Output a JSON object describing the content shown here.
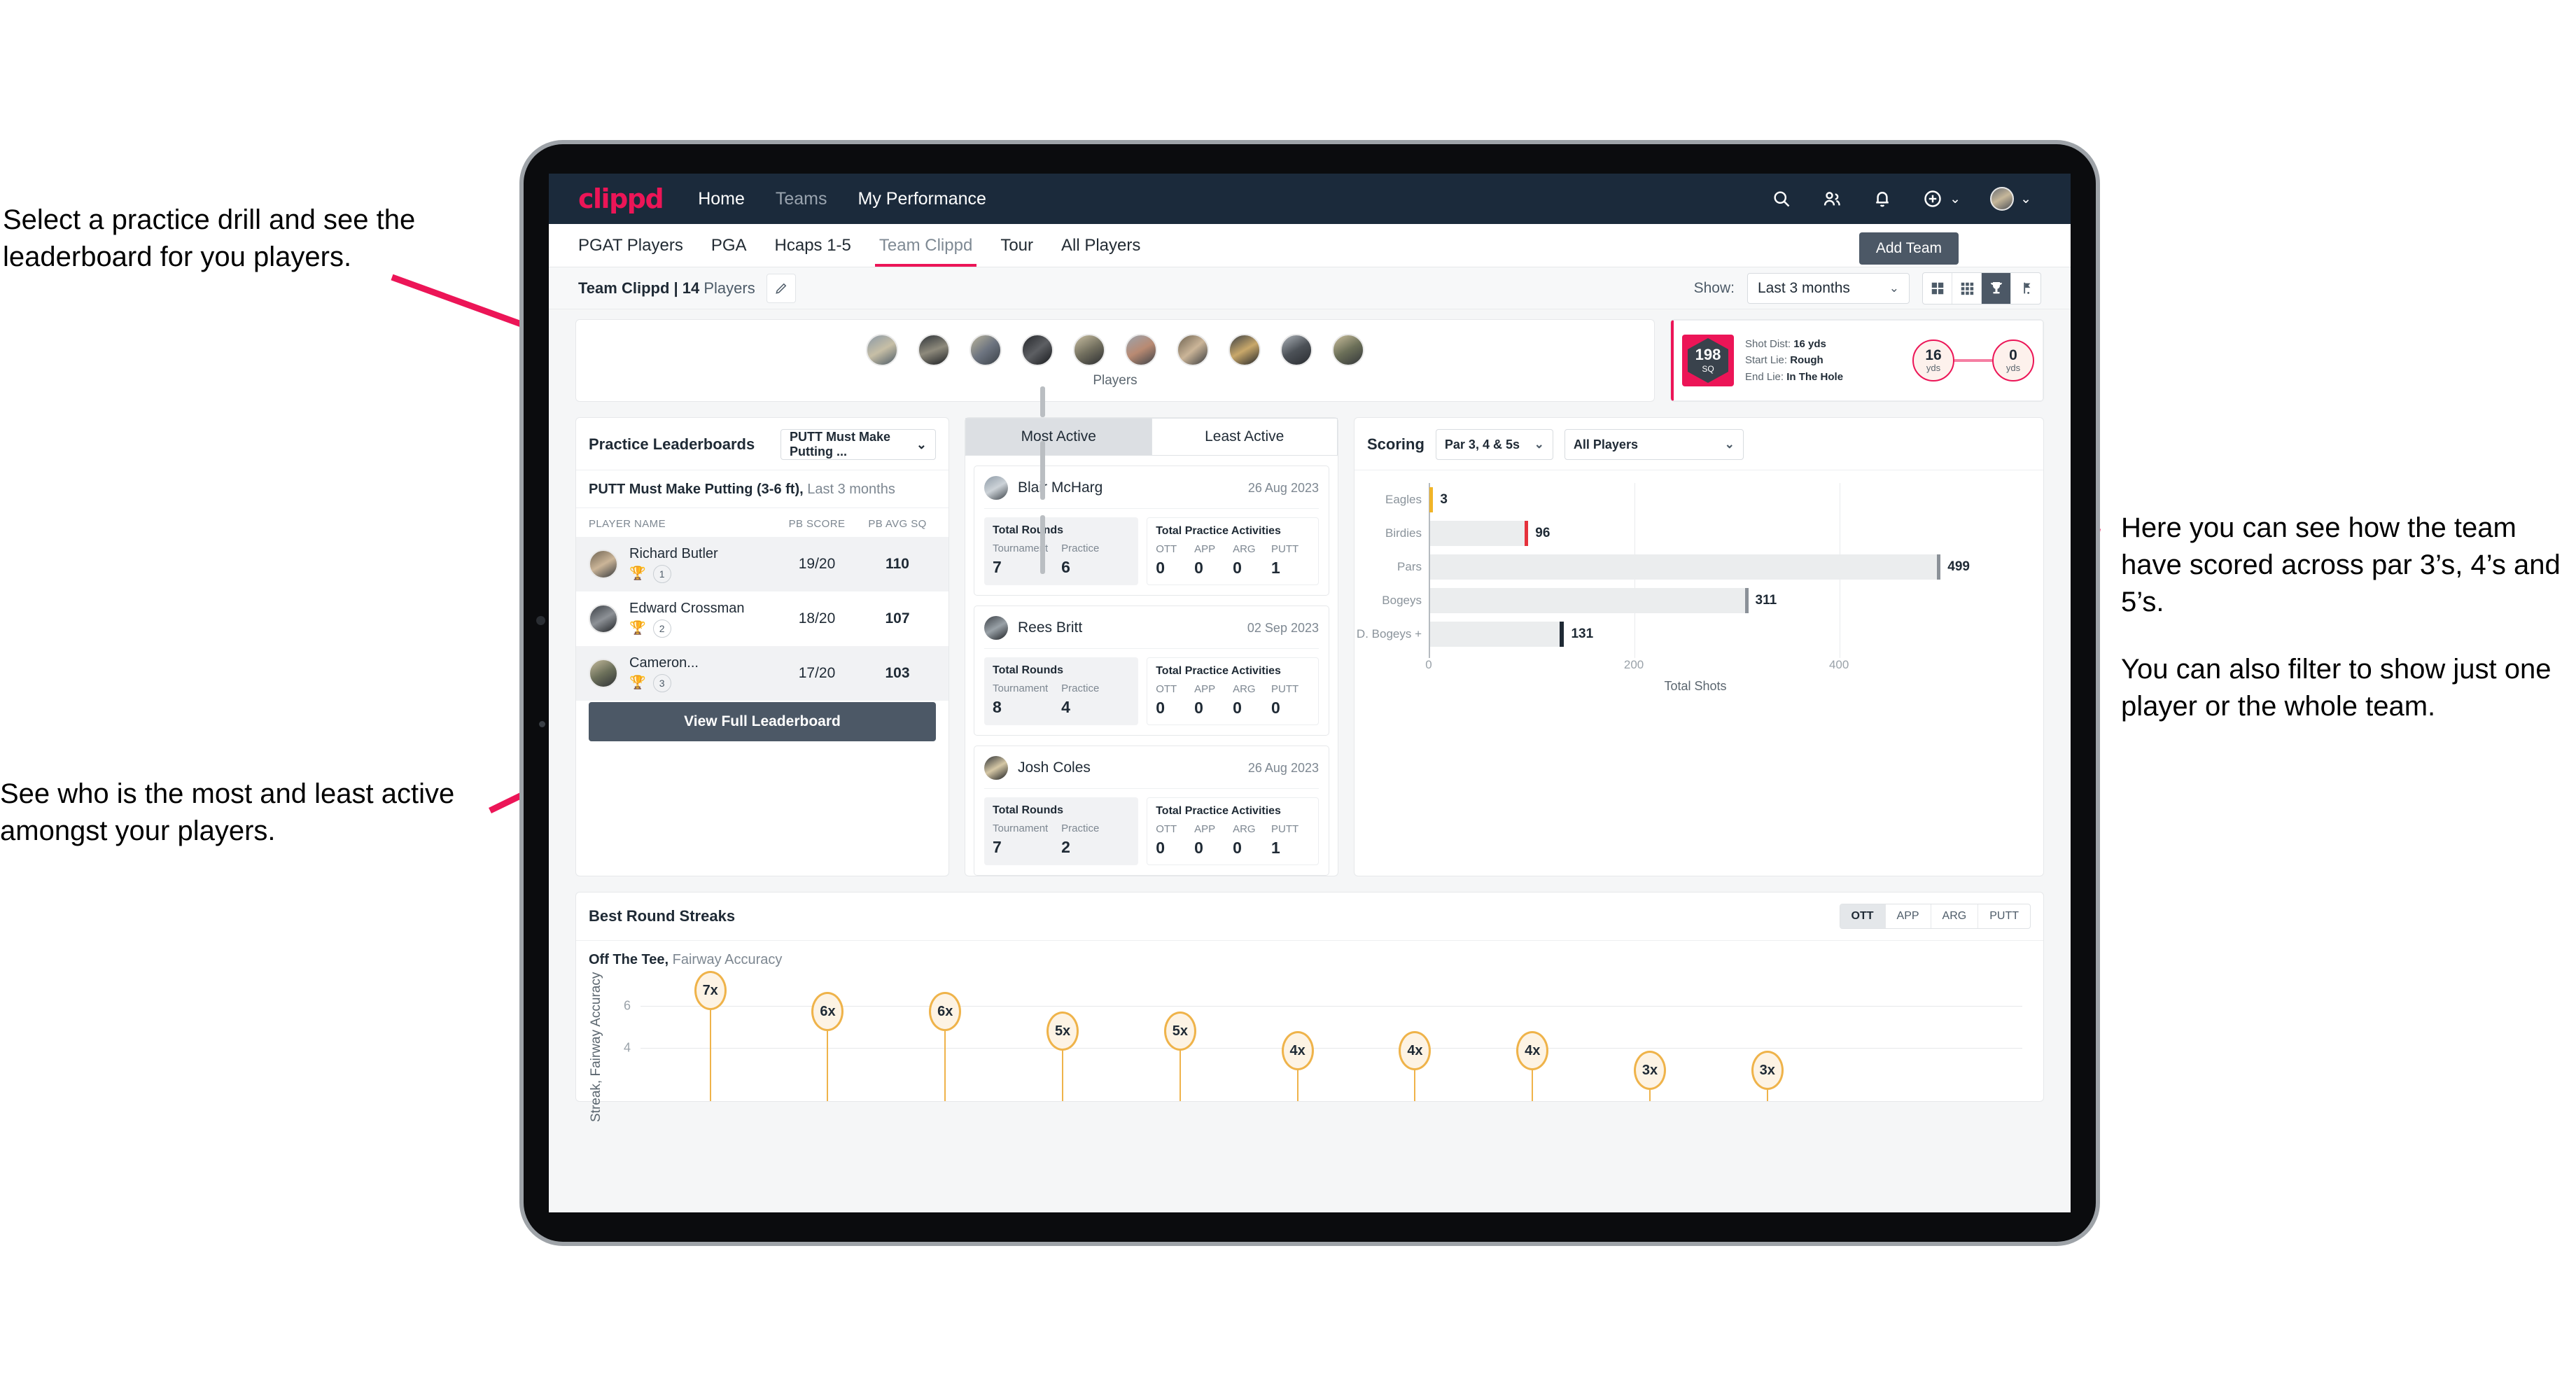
{
  "annotations": {
    "top_left": "Select a practice drill and see the leaderboard for you players.",
    "bottom_left": "See who is the most and least active amongst your players.",
    "right_1": "Here you can see how the team have scored across par 3’s, 4’s and 5’s.",
    "right_2": "You can also filter to show just one player or the whole team."
  },
  "colors": {
    "brand_pink": "#ec1557",
    "navy": "#1b2a3b",
    "slate": "#4c5866",
    "amber": "#efb34a"
  },
  "navbar": {
    "logo": "clippd",
    "links": [
      {
        "label": "Home",
        "active": true
      },
      {
        "label": "Teams",
        "active": false
      },
      {
        "label": "My Performance",
        "active": true
      }
    ],
    "icons": [
      "search-icon",
      "people-icon",
      "bell-icon",
      "plus-circle-icon",
      "avatar"
    ]
  },
  "tabs": {
    "items": [
      {
        "label": "PGAT Players",
        "active": false
      },
      {
        "label": "PGA",
        "active": false
      },
      {
        "label": "Hcaps 1-5",
        "active": false
      },
      {
        "label": "Team Clippd",
        "active": true
      },
      {
        "label": "Tour",
        "active": false
      },
      {
        "label": "All Players",
        "active": false
      }
    ],
    "add_team_label": "Add Team"
  },
  "subheader": {
    "team_name": "Team Clippd | 14",
    "team_suffix": " Players",
    "show_label": "Show:",
    "period_value": "Last 3 months",
    "view_icons": [
      {
        "name": "grid-large-icon",
        "selected": false
      },
      {
        "name": "grid-small-icon",
        "selected": false
      },
      {
        "name": "trophy-icon",
        "selected": true
      },
      {
        "name": "golf-flag-icon",
        "selected": false
      }
    ]
  },
  "players_strip": {
    "caption": "Players",
    "count": 10
  },
  "shot_card": {
    "sq_value": "198",
    "sq_unit": "SQ",
    "rows": [
      {
        "label": "Shot Dist:",
        "value": "16 yds"
      },
      {
        "label": "Start Lie:",
        "value": "Rough"
      },
      {
        "label": "End Lie:",
        "value": "In The Hole"
      }
    ],
    "start_yds": "16",
    "start_unit": "yds",
    "end_yds": "0",
    "end_unit": "yds"
  },
  "leaderboard": {
    "title": "Practice Leaderboards",
    "drill_select": "PUTT Must Make Putting ...",
    "subtitle_bold": "PUTT Must Make Putting (3-6 ft),",
    "subtitle_rest": " Last 3 months",
    "columns": [
      "PLAYER NAME",
      "PB SCORE",
      "PB AVG SQ"
    ],
    "rows": [
      {
        "name": "Richard Butler",
        "rank": "1",
        "medal": "gold",
        "pb_score": "19/20",
        "pb_avg_sq": "110"
      },
      {
        "name": "Edward Crossman",
        "rank": "2",
        "medal": "silver",
        "pb_score": "18/20",
        "pb_avg_sq": "107"
      },
      {
        "name": "Cameron...",
        "rank": "3",
        "medal": "bronze",
        "pb_score": "17/20",
        "pb_avg_sq": "103"
      }
    ],
    "button_label": "View Full Leaderboard"
  },
  "activity": {
    "tabs": [
      {
        "label": "Most Active",
        "active": true
      },
      {
        "label": "Least Active",
        "active": false
      }
    ],
    "rounds_title": "Total Rounds",
    "rounds_keys": [
      "Tournament",
      "Practice"
    ],
    "practice_title": "Total Practice Activities",
    "practice_keys": [
      "OTT",
      "APP",
      "ARG",
      "PUTT"
    ],
    "cards": [
      {
        "name": "Blair McHarg",
        "date": "26 Aug 2023",
        "rounds": [
          "7",
          "6"
        ],
        "practice": [
          "0",
          "0",
          "0",
          "1"
        ]
      },
      {
        "name": "Rees Britt",
        "date": "02 Sep 2023",
        "rounds": [
          "8",
          "4"
        ],
        "practice": [
          "0",
          "0",
          "0",
          "0"
        ]
      },
      {
        "name": "Josh Coles",
        "date": "26 Aug 2023",
        "rounds": [
          "7",
          "2"
        ],
        "practice": [
          "0",
          "0",
          "0",
          "1"
        ]
      }
    ]
  },
  "scoring": {
    "title": "Scoring",
    "select_par": "Par 3, 4 & 5s",
    "select_players": "All Players"
  },
  "streaks": {
    "title": "Best Round Streaks",
    "segments": [
      {
        "label": "OTT",
        "active": true
      },
      {
        "label": "APP",
        "active": false
      },
      {
        "label": "ARG",
        "active": false
      },
      {
        "label": "PUTT",
        "active": false
      }
    ],
    "sub_bold": "Off The Tee,",
    "sub_rest": " Fairway Accuracy"
  },
  "chart_data": [
    {
      "type": "bar",
      "orientation": "horizontal",
      "title": "Scoring",
      "categories": [
        "Eagles",
        "Birdies",
        "Pars",
        "Bogeys",
        "D. Bogeys +"
      ],
      "values": [
        3,
        96,
        499,
        311,
        131
      ],
      "cap_colors": [
        "#f0b429",
        "#e5313c",
        "#8b9198",
        "#8b9198",
        "#1f2a35"
      ],
      "xlabel": "Total Shots",
      "ylabel": "",
      "xlim": [
        0,
        520
      ],
      "xticks": [
        0,
        200,
        400
      ],
      "grid": true,
      "legend": "none"
    },
    {
      "type": "bar",
      "variant": "lollipop",
      "title": "Best Round Streaks",
      "subtitle": "Off The Tee, Fairway Accuracy",
      "ylabel": "Streak, Fairway Accuracy",
      "xlabel": "",
      "categories": [
        "",
        "",
        "",
        "",
        "",
        "",
        "",
        "",
        "",
        "",
        ""
      ],
      "values": [
        7,
        6,
        6,
        5,
        5,
        4,
        4,
        4,
        3,
        3
      ],
      "labels": [
        "7x",
        "6x",
        "6x",
        "5x",
        "5x",
        "4x",
        "4x",
        "4x",
        "3x",
        "3x"
      ],
      "yticks": [
        4,
        6
      ],
      "ylim": [
        0,
        8
      ],
      "grid": true,
      "legend": "none"
    }
  ]
}
